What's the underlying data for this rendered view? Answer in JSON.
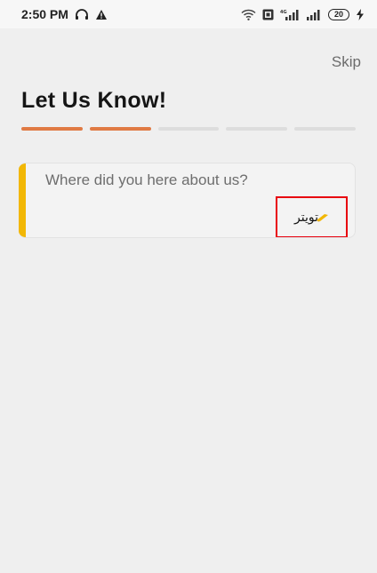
{
  "status_bar": {
    "time": "2:50 PM",
    "battery_level": "20",
    "icons": [
      "headphones-icon",
      "warning-icon",
      "wifi-icon",
      "sim-icon",
      "4g-signal-icon",
      "signal-icon",
      "battery-icon",
      "charging-icon"
    ]
  },
  "header": {
    "skip_label": "Skip",
    "title": "Let Us Know!"
  },
  "progress": {
    "total_steps": 5,
    "completed_steps": 2,
    "colors": {
      "done": "#e07a44",
      "todo": "#dddddd"
    }
  },
  "question_card": {
    "question": "Where did you here about us?",
    "answer": "تويتر",
    "accent_color": "#f2b705",
    "answer_icon": "pencil-icon"
  }
}
